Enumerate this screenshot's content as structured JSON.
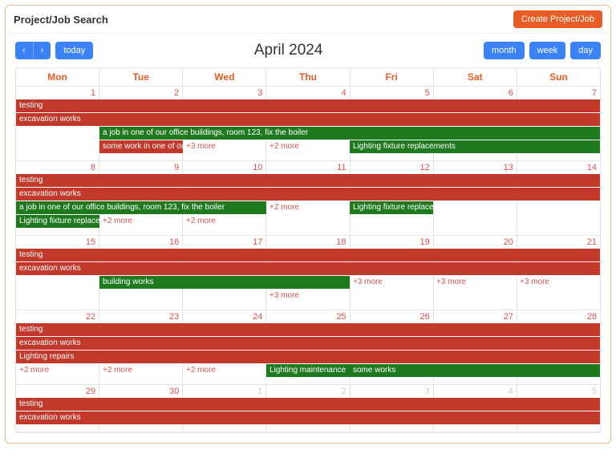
{
  "header": {
    "title": "Project/Job Search",
    "createBtn": "Create Project/Job"
  },
  "toolbar": {
    "prev": "‹",
    "next": "›",
    "today": "today",
    "title": "April 2024",
    "month": "month",
    "week": "week",
    "day": "day"
  },
  "dow": [
    "Mon",
    "Tue",
    "Wed",
    "Thu",
    "Fri",
    "Sat",
    "Sun"
  ],
  "weeks": [
    {
      "days": [
        {
          "n": "1"
        },
        {
          "n": "2"
        },
        {
          "n": "3"
        },
        {
          "n": "4"
        },
        {
          "n": "5"
        },
        {
          "n": "6"
        },
        {
          "n": "7"
        }
      ],
      "events": [
        {
          "row": 0,
          "start": 0,
          "span": 7,
          "color": "red",
          "text": "testing"
        },
        {
          "row": 1,
          "start": 0,
          "span": 7,
          "color": "red",
          "text": "excavation works"
        },
        {
          "row": 2,
          "start": 1,
          "span": 6,
          "color": "green",
          "text": "a job in one of our office buildings, room 123, fix the boiler"
        },
        {
          "row": 3,
          "start": 1,
          "span": 1,
          "color": "red",
          "text": "some work in one of our are"
        },
        {
          "row": 3,
          "start": 2,
          "span": 1,
          "color": "more",
          "text": "+3 more"
        },
        {
          "row": 3,
          "start": 3,
          "span": 1,
          "color": "more",
          "text": "+2 more"
        },
        {
          "row": 3,
          "start": 4,
          "span": 3,
          "color": "green",
          "text": "Lighting fixture replacements"
        }
      ]
    },
    {
      "days": [
        {
          "n": "8"
        },
        {
          "n": "9"
        },
        {
          "n": "10"
        },
        {
          "n": "11"
        },
        {
          "n": "12"
        },
        {
          "n": "13"
        },
        {
          "n": "14"
        }
      ],
      "events": [
        {
          "row": 0,
          "start": 0,
          "span": 7,
          "color": "red",
          "text": "testing"
        },
        {
          "row": 1,
          "start": 0,
          "span": 7,
          "color": "red",
          "text": "excavation works"
        },
        {
          "row": 2,
          "start": 0,
          "span": 3,
          "color": "green",
          "text": "a job in one of our office buildings, room 123, fix the boiler"
        },
        {
          "row": 2,
          "start": 3,
          "span": 1,
          "color": "more",
          "text": "+2 more"
        },
        {
          "row": 2,
          "start": 4,
          "span": 1,
          "color": "green",
          "text": "Lighting fixture replacement"
        },
        {
          "row": 3,
          "start": 0,
          "span": 1,
          "color": "green",
          "text": "Lighting fixture replacements"
        },
        {
          "row": 3,
          "start": 1,
          "span": 1,
          "color": "more",
          "text": "+2 more"
        },
        {
          "row": 3,
          "start": 2,
          "span": 1,
          "color": "more",
          "text": "+2 more"
        }
      ]
    },
    {
      "days": [
        {
          "n": "15"
        },
        {
          "n": "16"
        },
        {
          "n": "17"
        },
        {
          "n": "18"
        },
        {
          "n": "19"
        },
        {
          "n": "20"
        },
        {
          "n": "21"
        }
      ],
      "events": [
        {
          "row": 0,
          "start": 0,
          "span": 7,
          "color": "red",
          "text": "testing"
        },
        {
          "row": 1,
          "start": 0,
          "span": 7,
          "color": "red",
          "text": "excavation works"
        },
        {
          "row": 2,
          "start": 1,
          "span": 3,
          "color": "green",
          "text": "building works"
        },
        {
          "row": 2,
          "start": 4,
          "span": 1,
          "color": "more",
          "text": "+3 more"
        },
        {
          "row": 2,
          "start": 5,
          "span": 1,
          "color": "more",
          "text": "+3 more"
        },
        {
          "row": 2,
          "start": 6,
          "span": 1,
          "color": "more",
          "text": "+3 more"
        },
        {
          "row": 3,
          "start": 3,
          "span": 1,
          "color": "more",
          "text": "+3 more"
        }
      ]
    },
    {
      "days": [
        {
          "n": "22"
        },
        {
          "n": "23"
        },
        {
          "n": "24"
        },
        {
          "n": "25"
        },
        {
          "n": "26"
        },
        {
          "n": "27"
        },
        {
          "n": "28"
        }
      ],
      "events": [
        {
          "row": 0,
          "start": 0,
          "span": 7,
          "color": "red",
          "text": "testing"
        },
        {
          "row": 1,
          "start": 0,
          "span": 7,
          "color": "red",
          "text": "excavation works"
        },
        {
          "row": 2,
          "start": 0,
          "span": 7,
          "color": "red",
          "text": "Lighting repairs"
        },
        {
          "row": 3,
          "start": 0,
          "span": 1,
          "color": "more",
          "text": "+2 more"
        },
        {
          "row": 3,
          "start": 1,
          "span": 1,
          "color": "more",
          "text": "+2 more"
        },
        {
          "row": 3,
          "start": 2,
          "span": 1,
          "color": "more",
          "text": "+2 more"
        },
        {
          "row": 3,
          "start": 3,
          "span": 1,
          "color": "green",
          "text": "Lighting maintenance"
        },
        {
          "row": 3,
          "start": 4,
          "span": 3,
          "color": "green",
          "text": "some works"
        }
      ]
    },
    {
      "short": true,
      "days": [
        {
          "n": "29"
        },
        {
          "n": "30"
        },
        {
          "n": "1",
          "muted": true
        },
        {
          "n": "2",
          "muted": true
        },
        {
          "n": "3",
          "muted": true
        },
        {
          "n": "4",
          "muted": true
        },
        {
          "n": "5",
          "muted": true
        }
      ],
      "events": [
        {
          "row": 0,
          "start": 0,
          "span": 7,
          "color": "red",
          "text": "testing"
        },
        {
          "row": 1,
          "start": 0,
          "span": 7,
          "color": "red",
          "text": "excavation works"
        }
      ]
    }
  ]
}
